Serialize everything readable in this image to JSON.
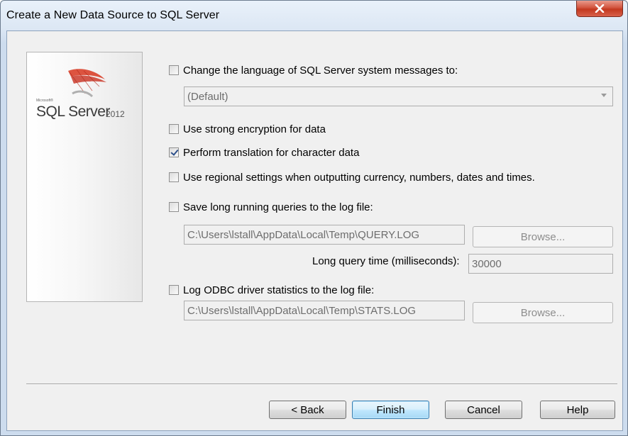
{
  "window": {
    "title": "Create a New Data Source to SQL Server",
    "close_icon": "close-icon"
  },
  "banner": {
    "microsoft": "Microsoft®",
    "product": "SQL Server",
    "version": "2012"
  },
  "options": {
    "language": {
      "label": "Change the language of SQL Server system messages to:",
      "checked": false
    },
    "language_select": {
      "value": "(Default)"
    },
    "encryption": {
      "label": "Use strong encryption for data",
      "checked": false
    },
    "translation": {
      "label": "Perform translation for character data",
      "checked": true
    },
    "regional": {
      "label": "Use regional settings when outputting currency, numbers, dates and times.",
      "checked": false
    },
    "long_queries": {
      "label": "Save long running queries to the log file:",
      "checked": false
    },
    "query_log_path": "C:\\Users\\lstall\\AppData\\Local\\Temp\\QUERY.LOG",
    "query_browse": "Browse...",
    "long_query_time_label": "Long query time (milliseconds):",
    "long_query_time_value": "30000",
    "odbc_stats": {
      "label": "Log ODBC driver statistics to the log file:",
      "checked": false
    },
    "stats_log_path": "C:\\Users\\lstall\\AppData\\Local\\Temp\\STATS.LOG",
    "stats_browse": "Browse..."
  },
  "buttons": {
    "back": "< Back",
    "finish": "Finish",
    "cancel": "Cancel",
    "help": "Help"
  }
}
